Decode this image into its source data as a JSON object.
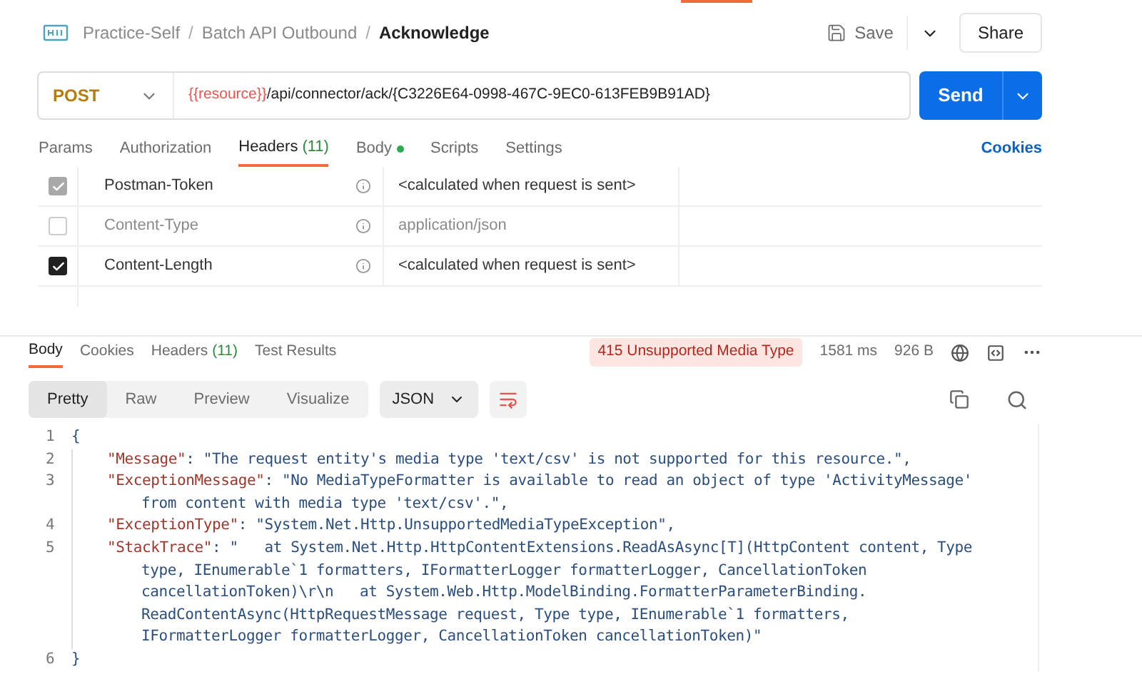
{
  "breadcrumb": {
    "items": [
      "Practice-Self",
      "Batch API Outbound"
    ],
    "current": "Acknowledge",
    "separator": "/"
  },
  "actions": {
    "save": "Save",
    "share": "Share"
  },
  "request": {
    "method": "POST",
    "url_variable": "{{resource}}",
    "url_path": "/api/connector/ack/{C3226E64-0998-467C-9EC0-613FEB9B91AD}",
    "send": "Send"
  },
  "request_tabs": [
    {
      "label": "Params",
      "selected": false
    },
    {
      "label": "Authorization",
      "selected": false
    },
    {
      "label": "Headers",
      "count": "(11)",
      "selected": true
    },
    {
      "label": "Body",
      "dot": true,
      "selected": false
    },
    {
      "label": "Scripts",
      "selected": false
    },
    {
      "label": "Settings",
      "selected": false
    }
  ],
  "cookies_link": "Cookies",
  "headers": [
    {
      "key": "Postman-Token",
      "value": "<calculated when request is sent>",
      "checked": true,
      "disabled": true
    },
    {
      "key": "Content-Type",
      "value": "application/json",
      "checked": false,
      "disabled": false
    },
    {
      "key": "Content-Length",
      "value": "<calculated when request is sent>",
      "checked": true,
      "disabled": false
    }
  ],
  "response_tabs": [
    {
      "label": "Body",
      "selected": true
    },
    {
      "label": "Cookies",
      "selected": false
    },
    {
      "label": "Headers",
      "count": "(11)",
      "selected": false
    },
    {
      "label": "Test Results",
      "selected": false
    }
  ],
  "status": {
    "code": "415 Unsupported Media Type",
    "time": "1581 ms",
    "size": "926 B"
  },
  "view_modes": [
    {
      "label": "Pretty",
      "selected": true
    },
    {
      "label": "Raw",
      "selected": false
    },
    {
      "label": "Preview",
      "selected": false
    },
    {
      "label": "Visualize",
      "selected": false
    }
  ],
  "format": "JSON",
  "code": [
    {
      "number": "1",
      "rows": [
        {
          "value": "{"
        }
      ]
    },
    {
      "number": "2",
      "rows": [
        {
          "key": "\"Message\"",
          "value": ": \"The request entity's media type 'text/csv' is not supported for this resource.\","
        }
      ]
    },
    {
      "number": "3",
      "rows": [
        {
          "key": "\"ExceptionMessage\"",
          "value": ": \"No MediaTypeFormatter is available to read an object of type 'ActivityMessage'"
        },
        {
          "value": "from content with media type 'text/csv'.\","
        }
      ]
    },
    {
      "number": "4",
      "rows": [
        {
          "key": "\"ExceptionType\"",
          "value": ": \"System.Net.Http.UnsupportedMediaTypeException\","
        }
      ]
    },
    {
      "number": "5",
      "rows": [
        {
          "key": "\"StackTrace\"",
          "value": ": \"   at System.Net.Http.HttpContentExtensions.ReadAsAsync[T](HttpContent content, Type"
        },
        {
          "value": "type, IEnumerable`1 formatters, IFormatterLogger formatterLogger, CancellationToken"
        },
        {
          "value": "cancellationToken)\\r\\n   at System.Web.Http.ModelBinding.FormatterParameterBinding."
        },
        {
          "value": "ReadContentAsync(HttpRequestMessage request, Type type, IEnumerable`1 formatters,"
        },
        {
          "value": "IFormatterLogger formatterLogger, CancellationToken cancellationToken)\""
        }
      ]
    },
    {
      "number": "6",
      "rows": [
        {
          "value": "}"
        }
      ]
    }
  ]
}
